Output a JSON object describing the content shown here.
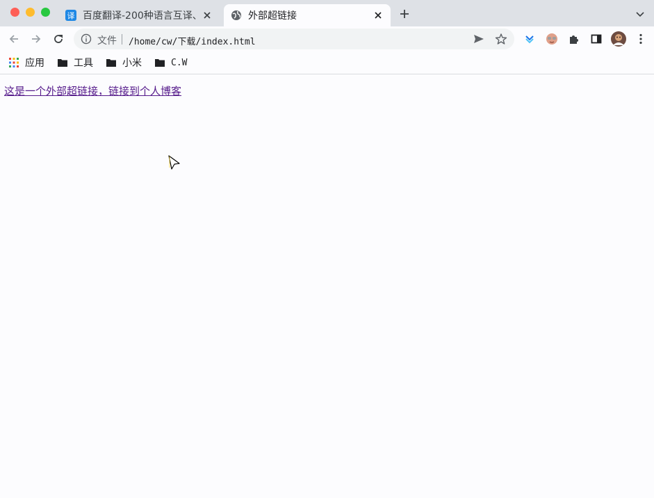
{
  "tabs": [
    {
      "title": "百度翻译-200种语言互译、",
      "favicon": "translate-icon",
      "active": false
    },
    {
      "title": "外部超链接",
      "favicon": "globe-icon",
      "active": true
    }
  ],
  "toolbar": {
    "scheme_label": "文件",
    "url": "/home/cw/下载/index.html"
  },
  "bookmarks": [
    {
      "label": "应用",
      "icon": "apps-grid-icon"
    },
    {
      "label": "工具",
      "icon": "folder-icon"
    },
    {
      "label": "小米",
      "icon": "folder-icon"
    },
    {
      "label": "C.W",
      "icon": "folder-icon"
    }
  ],
  "content": {
    "link_text": "这是一个外部超链接，链接到个人博客"
  },
  "colors": {
    "tabstrip": "#dee1e6",
    "visited_link": "#551a8b",
    "translate_favicon": "#1e88e5"
  }
}
